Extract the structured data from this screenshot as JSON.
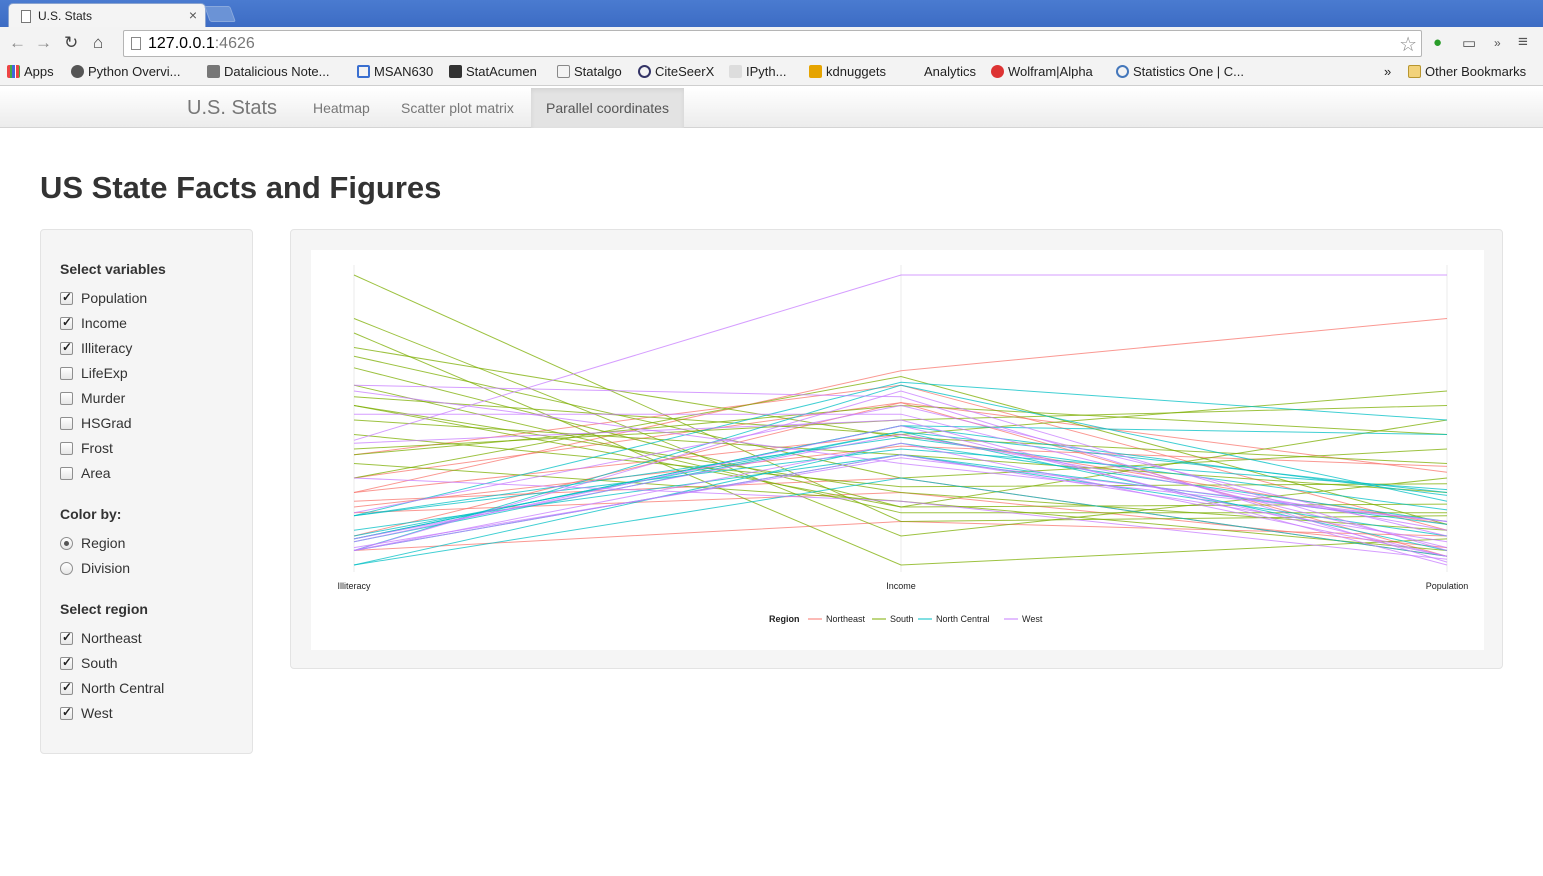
{
  "browser": {
    "tab_title": "U.S. Stats",
    "tab_close": "×",
    "url_host": "127.0.0.1",
    "url_port": ":4626",
    "bookmarks": [
      "Apps",
      "Python Overvi...",
      "Datalicious Note...",
      "MSAN630",
      "StatAcumen",
      "Statalgo",
      "CiteSeerX",
      "IPyth...",
      "kdnuggets",
      "Analytics",
      "Wolfram|Alpha",
      "Statistics One | C...",
      "»",
      "Other Bookmarks"
    ]
  },
  "navbar": {
    "brand": "U.S. Stats",
    "links": [
      "Heatmap",
      "Scatter plot matrix",
      "Parallel coordinates"
    ],
    "active": "Parallel coordinates"
  },
  "page_title": "US State Facts and Figures",
  "sidebar": {
    "variables_title": "Select variables",
    "variables": [
      {
        "label": "Population",
        "checked": true
      },
      {
        "label": "Income",
        "checked": true
      },
      {
        "label": "Illiteracy",
        "checked": true
      },
      {
        "label": "LifeExp",
        "checked": false
      },
      {
        "label": "Murder",
        "checked": false
      },
      {
        "label": "HSGrad",
        "checked": false
      },
      {
        "label": "Frost",
        "checked": false
      },
      {
        "label": "Area",
        "checked": false
      }
    ],
    "color_title": "Color by:",
    "color_options": [
      {
        "label": "Region",
        "checked": true
      },
      {
        "label": "Division",
        "checked": false
      }
    ],
    "region_title": "Select region",
    "regions": [
      {
        "label": "Northeast",
        "checked": true
      },
      {
        "label": "South",
        "checked": true
      },
      {
        "label": "North Central",
        "checked": true
      },
      {
        "label": "West",
        "checked": true
      }
    ]
  },
  "chart_data": {
    "type": "line",
    "subtype": "parallel-coordinates",
    "axes": [
      "Illiteracy",
      "Income",
      "Population"
    ],
    "scale": "each axis normalized 0 (bottom) to 1 (top)",
    "legend": {
      "title": "Region",
      "position": "bottom",
      "entries": [
        "Northeast",
        "South",
        "North Central",
        "West"
      ]
    },
    "colors": {
      "Northeast": "#F8766D",
      "South": "#7CAE00",
      "North Central": "#00BFC4",
      "West": "#C77CFF"
    },
    "series": [
      {
        "name": "Northeast",
        "values": [
          [
            0.25,
            0.45,
            0.14
          ],
          [
            0.25,
            0.67,
            0.85
          ],
          [
            0.38,
            0.62,
            0.12
          ],
          [
            0.1,
            0.56,
            0.03
          ],
          [
            0.3,
            0.56,
            0.32
          ],
          [
            0.2,
            0.41,
            0.34
          ],
          [
            0.18,
            0.25,
            0.06
          ],
          [
            0.22,
            0.3,
            0.03
          ],
          [
            0.05,
            0.15,
            0.1
          ]
        ]
      },
      {
        "name": "South",
        "values": [
          [
            1.0,
            0.15,
            0.17
          ],
          [
            0.8,
            0.0,
            0.09
          ],
          [
            0.75,
            0.44,
            0.35
          ],
          [
            0.55,
            0.2,
            0.5
          ],
          [
            0.55,
            0.25,
            0.12
          ],
          [
            0.38,
            0.55,
            0.45
          ],
          [
            0.68,
            0.2,
            0.21
          ],
          [
            0.62,
            0.18,
            0.18
          ],
          [
            0.85,
            0.1,
            0.3
          ],
          [
            0.72,
            0.3,
            0.4
          ],
          [
            0.4,
            0.5,
            0.55
          ],
          [
            0.45,
            0.27,
            0.28
          ],
          [
            0.58,
            0.45,
            0.6
          ],
          [
            0.5,
            0.38,
            0.25
          ],
          [
            0.3,
            0.65,
            0.14
          ],
          [
            0.35,
            0.22,
            0.05
          ]
        ]
      },
      {
        "name": "North Central",
        "values": [
          [
            0.17,
            0.63,
            0.5
          ],
          [
            0.09,
            0.48,
            0.45
          ],
          [
            0.17,
            0.4,
            0.26
          ],
          [
            0.09,
            0.48,
            0.24
          ],
          [
            0.05,
            0.38,
            0.1
          ],
          [
            0.0,
            0.42,
            0.15
          ],
          [
            0.08,
            0.46,
            0.25
          ],
          [
            0.12,
            0.38,
            0.14
          ],
          [
            0.05,
            0.62,
            0.22
          ],
          [
            0.0,
            0.3,
            0.03
          ],
          [
            0.1,
            0.46,
            0.05
          ],
          [
            0.17,
            0.44,
            0.19
          ]
        ]
      },
      {
        "name": "West",
        "values": [
          [
            0.43,
            1.0,
            1.0
          ],
          [
            0.05,
            0.42,
            0.03
          ],
          [
            0.18,
            0.55,
            0.1
          ],
          [
            0.6,
            0.35,
            0.15
          ],
          [
            0.05,
            0.6,
            0.05
          ],
          [
            0.3,
            0.22,
            0.02
          ],
          [
            0.62,
            0.58,
            0.01
          ],
          [
            0.06,
            0.37,
            0.15
          ],
          [
            0.42,
            0.5,
            0.0
          ],
          [
            0.09,
            0.45,
            0.12
          ],
          [
            0.05,
            0.38,
            0.08
          ],
          [
            0.08,
            0.48,
            0.03
          ],
          [
            0.52,
            0.52,
            0.06
          ]
        ]
      }
    ]
  }
}
